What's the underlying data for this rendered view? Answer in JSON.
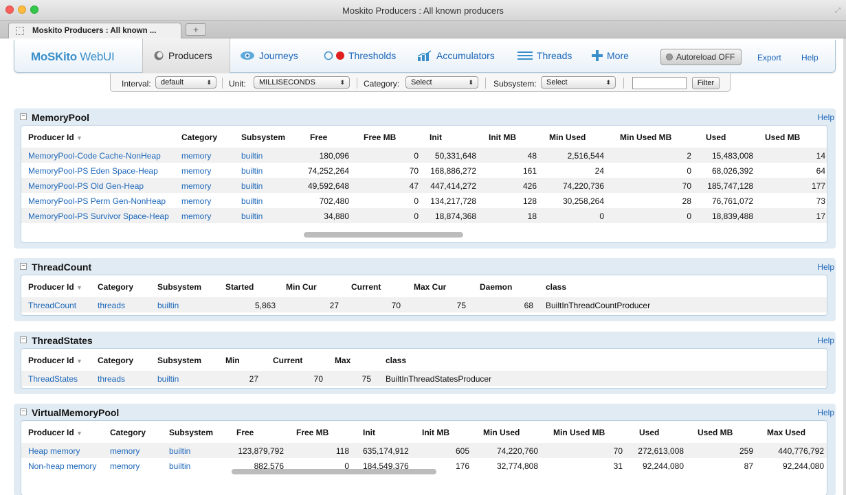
{
  "window": {
    "title": "Moskito Producers : All known producers"
  },
  "browser_tab": {
    "label": "Moskito Producers : All known ...",
    "new_tab": "+"
  },
  "nav": {
    "logo": "MoSKito",
    "logo_ui": " WebUI",
    "producers": "Producers",
    "journeys": "Journeys",
    "thresholds": "Thresholds",
    "accumulators": "Accumulators",
    "threads": "Threads",
    "more": "More",
    "autoreload": "Autoreload OFF",
    "export": "Export",
    "help": "Help"
  },
  "filters": {
    "interval_label": "Interval:",
    "interval_value": "default",
    "unit_label": "Unit:",
    "unit_value": "MILLISECONDS",
    "category_label": "Category:",
    "category_value": "Select",
    "subsystem_label": "Subsystem:",
    "subsystem_value": "Select",
    "filter_text": "",
    "filter_button": "Filter"
  },
  "help_label": "Help",
  "colors": {
    "accent": "#1b66b9",
    "panel_bg": "#e1ebf4",
    "threshold_red": "#e02020"
  },
  "memory_pool": {
    "title": "MemoryPool",
    "headers": [
      "Producer Id",
      "Category",
      "Subsystem",
      "Free",
      "Free MB",
      "Init",
      "Init MB",
      "Min Used",
      "Min Used MB",
      "Used",
      "Used MB"
    ],
    "rows": [
      [
        "MemoryPool-Code Cache-NonHeap",
        "memory",
        "builtin",
        "180,096",
        "0",
        "50,331,648",
        "48",
        "2,516,544",
        "2",
        "15,483,008",
        "14"
      ],
      [
        "MemoryPool-PS Eden Space-Heap",
        "memory",
        "builtin",
        "74,252,264",
        "70",
        "168,886,272",
        "161",
        "24",
        "0",
        "68,026,392",
        "64"
      ],
      [
        "MemoryPool-PS Old Gen-Heap",
        "memory",
        "builtin",
        "49,592,648",
        "47",
        "447,414,272",
        "426",
        "74,220,736",
        "70",
        "185,747,128",
        "177"
      ],
      [
        "MemoryPool-PS Perm Gen-NonHeap",
        "memory",
        "builtin",
        "702,480",
        "0",
        "134,217,728",
        "128",
        "30,258,264",
        "28",
        "76,761,072",
        "73"
      ],
      [
        "MemoryPool-PS Survivor Space-Heap",
        "memory",
        "builtin",
        "34,880",
        "0",
        "18,874,368",
        "18",
        "0",
        "0",
        "18,839,488",
        "17"
      ]
    ]
  },
  "thread_count": {
    "title": "ThreadCount",
    "headers": [
      "Producer Id",
      "Category",
      "Subsystem",
      "Started",
      "Min Cur",
      "Current",
      "Max Cur",
      "Daemon",
      "class"
    ],
    "rows": [
      [
        "ThreadCount",
        "threads",
        "builtin",
        "5,863",
        "27",
        "70",
        "75",
        "68",
        "BuiltInThreadCountProducer"
      ]
    ]
  },
  "thread_states": {
    "title": "ThreadStates",
    "headers": [
      "Producer Id",
      "Category",
      "Subsystem",
      "Min",
      "Current",
      "Max",
      "class"
    ],
    "rows": [
      [
        "ThreadStates",
        "threads",
        "builtin",
        "27",
        "70",
        "75",
        "BuiltInThreadStatesProducer"
      ]
    ]
  },
  "virtual_memory_pool": {
    "title": "VirtualMemoryPool",
    "headers": [
      "Producer Id",
      "Category",
      "Subsystem",
      "Free",
      "Free MB",
      "Init",
      "Init MB",
      "Min Used",
      "Min Used MB",
      "Used",
      "Used MB",
      "Max Used"
    ],
    "rows": [
      [
        "Heap memory",
        "memory",
        "builtin",
        "123,879,792",
        "118",
        "635,174,912",
        "605",
        "74,220,760",
        "70",
        "272,613,008",
        "259",
        "440,776,792"
      ],
      [
        "Non-heap memory",
        "memory",
        "builtin",
        "882,576",
        "0",
        "184,549,376",
        "176",
        "32,774,808",
        "31",
        "92,244,080",
        "87",
        "92,244,080"
      ]
    ]
  }
}
